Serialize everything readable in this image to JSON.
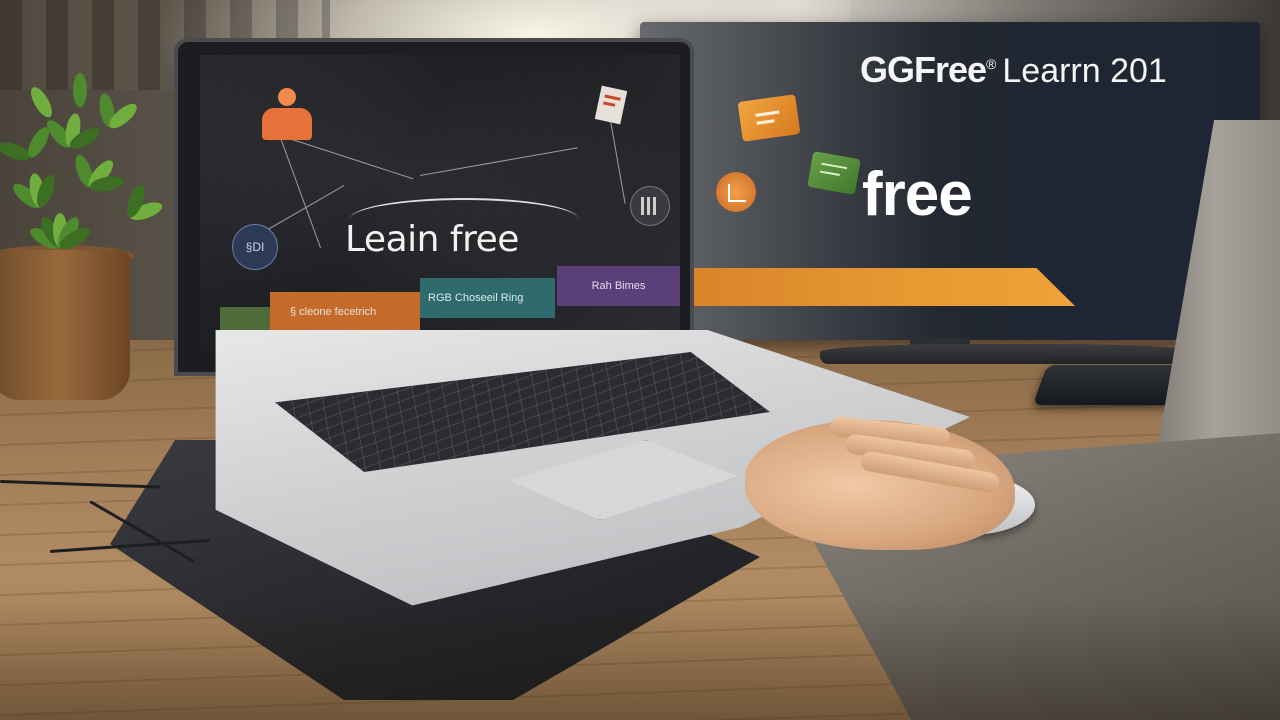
{
  "monitor": {
    "logo_bold": "GGFree",
    "logo_mark": "®",
    "logo_text": "Learrn 201",
    "headline": "free",
    "accent_color": "#e89a32",
    "background_color": "#1f2633"
  },
  "laptop_screen": {
    "title": "Leain free",
    "side_badge": "§DI",
    "bars": {
      "orange_label": "§ cleone fecetrich",
      "teal_label": "RGB Choseeil Ring",
      "purple_label": "Rah Bimes"
    },
    "colors": {
      "green": "#4e6b3a",
      "orange": "#c56b2a",
      "teal": "#2f6a6c",
      "purple": "#5a3f78"
    }
  },
  "icons": {
    "person_icon": "person-icon",
    "document_icon": "document-icon",
    "book_icon": "book-icon",
    "certificate_icon": "certificate-icon",
    "graph_icon": "graph-icon"
  }
}
